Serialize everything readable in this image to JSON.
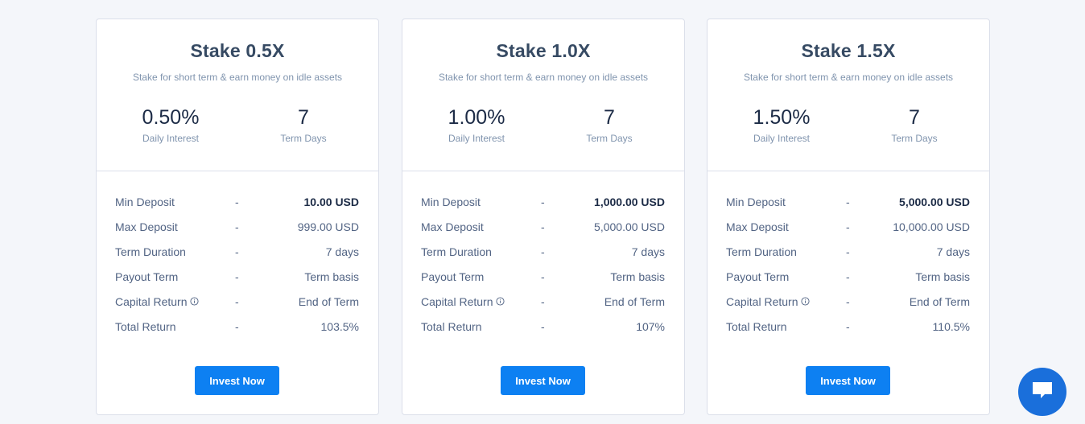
{
  "plans": [
    {
      "title": "Stake 0.5X",
      "subtitle": "Stake for short term & earn money on idle assets",
      "daily_interest": "0.50%",
      "daily_interest_label": "Daily Interest",
      "term_days": "7",
      "term_days_label": "Term Days",
      "rows": [
        {
          "label": "Min Deposit",
          "dash": "-",
          "value": "10.00 USD"
        },
        {
          "label": "Max Deposit",
          "dash": "-",
          "value": "999.00 USD"
        },
        {
          "label": "Term Duration",
          "dash": "-",
          "value": "7 days"
        },
        {
          "label": "Payout Term",
          "dash": "-",
          "value": "Term basis"
        },
        {
          "label": "Capital Return",
          "dash": "-",
          "value": "End of Term"
        },
        {
          "label": "Total Return",
          "dash": "-",
          "value": "103.5%"
        }
      ],
      "button_label": "Invest Now"
    },
    {
      "title": "Stake 1.0X",
      "subtitle": "Stake for short term & earn money on idle assets",
      "daily_interest": "1.00%",
      "daily_interest_label": "Daily Interest",
      "term_days": "7",
      "term_days_label": "Term Days",
      "rows": [
        {
          "label": "Min Deposit",
          "dash": "-",
          "value": "1,000.00 USD"
        },
        {
          "label": "Max Deposit",
          "dash": "-",
          "value": "5,000.00 USD"
        },
        {
          "label": "Term Duration",
          "dash": "-",
          "value": "7 days"
        },
        {
          "label": "Payout Term",
          "dash": "-",
          "value": "Term basis"
        },
        {
          "label": "Capital Return",
          "dash": "-",
          "value": "End of Term"
        },
        {
          "label": "Total Return",
          "dash": "-",
          "value": "107%"
        }
      ],
      "button_label": "Invest Now"
    },
    {
      "title": "Stake 1.5X",
      "subtitle": "Stake for short term & earn money on idle assets",
      "daily_interest": "1.50%",
      "daily_interest_label": "Daily Interest",
      "term_days": "7",
      "term_days_label": "Term Days",
      "rows": [
        {
          "label": "Min Deposit",
          "dash": "-",
          "value": "5,000.00 USD"
        },
        {
          "label": "Max Deposit",
          "dash": "-",
          "value": "10,000.00 USD"
        },
        {
          "label": "Term Duration",
          "dash": "-",
          "value": "7 days"
        },
        {
          "label": "Payout Term",
          "dash": "-",
          "value": "Term basis"
        },
        {
          "label": "Capital Return",
          "dash": "-",
          "value": "End of Term"
        },
        {
          "label": "Total Return",
          "dash": "-",
          "value": "110.5%"
        }
      ],
      "button_label": "Invest Now"
    }
  ],
  "icons": {
    "capital_return_info": "info-circle-icon",
    "chat": "chat-bubble-icon"
  },
  "colors": {
    "accent": "#0d80f2",
    "chat_button": "#1a6fdb",
    "page_background": "#f4f6fa",
    "card_border": "#dbdfea"
  }
}
